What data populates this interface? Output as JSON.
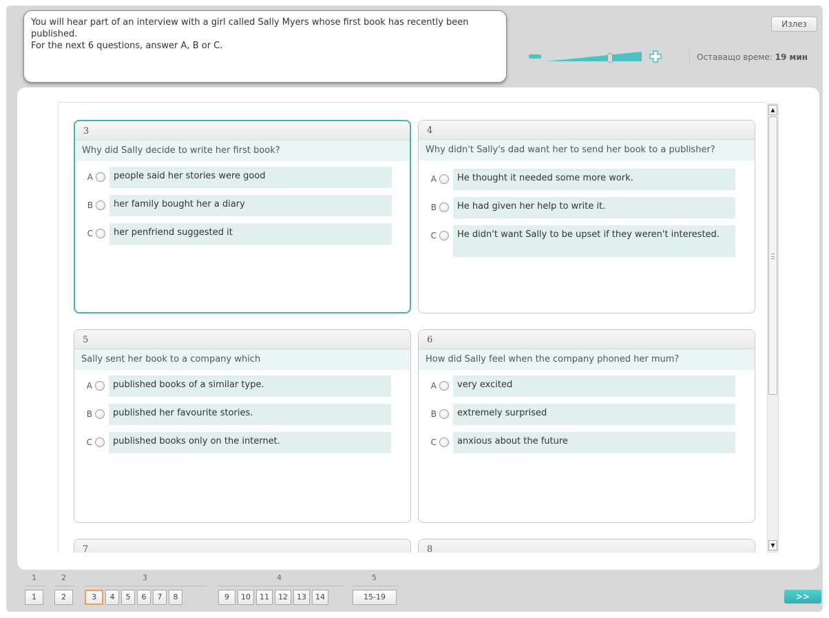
{
  "instructions": {
    "line1": "You will hear part of an interview with a girl called Sally Myers whose first book has recently been published.",
    "line2": "For the next 6 questions, answer A, B or C."
  },
  "header": {
    "exit_label": "Излез",
    "timer_label": "Оставащо време:",
    "timer_value": "19 мин",
    "zoom_level": 0.68
  },
  "questions": [
    {
      "number": "3",
      "text": "Why did Sally decide to write her first book?",
      "options": [
        {
          "letter": "A",
          "text": "people said her stories were good"
        },
        {
          "letter": "B",
          "text": "her family bought her a diary"
        },
        {
          "letter": "C",
          "text": "her penfriend suggested it"
        }
      ]
    },
    {
      "number": "4",
      "text": "Why didn't Sally's dad want her to send her book to a publisher?",
      "options": [
        {
          "letter": "A",
          "text": "He thought it needed some more work."
        },
        {
          "letter": "B",
          "text": "He had given her help to write it."
        },
        {
          "letter": "C",
          "text": "He didn't want Sally to be upset if they weren't interested."
        }
      ]
    },
    {
      "number": "5",
      "text": "Sally sent her book to a company which",
      "options": [
        {
          "letter": "A",
          "text": "published books of a similar type."
        },
        {
          "letter": "B",
          "text": "published her favourite stories."
        },
        {
          "letter": "C",
          "text": "published books only on the internet."
        }
      ]
    },
    {
      "number": "6",
      "text": "How did Sally feel when the company phoned her mum?",
      "options": [
        {
          "letter": "A",
          "text": "very excited"
        },
        {
          "letter": "B",
          "text": "extremely surprised"
        },
        {
          "letter": "C",
          "text": "anxious about the future"
        }
      ]
    },
    {
      "number": "7"
    },
    {
      "number": "8"
    }
  ],
  "navigation": {
    "groups": [
      {
        "label": "1",
        "items": [
          "1"
        ]
      },
      {
        "label": "2",
        "items": [
          "2"
        ]
      },
      {
        "label": "3",
        "items": [
          "3",
          "4",
          "5",
          "6",
          "7",
          "8"
        ]
      },
      {
        "label": "4",
        "items": [
          "9",
          "10",
          "11",
          "12",
          "13",
          "14"
        ]
      },
      {
        "label": "5",
        "items": [
          "15-19"
        ]
      }
    ],
    "current": "3",
    "next_label": ">>"
  }
}
